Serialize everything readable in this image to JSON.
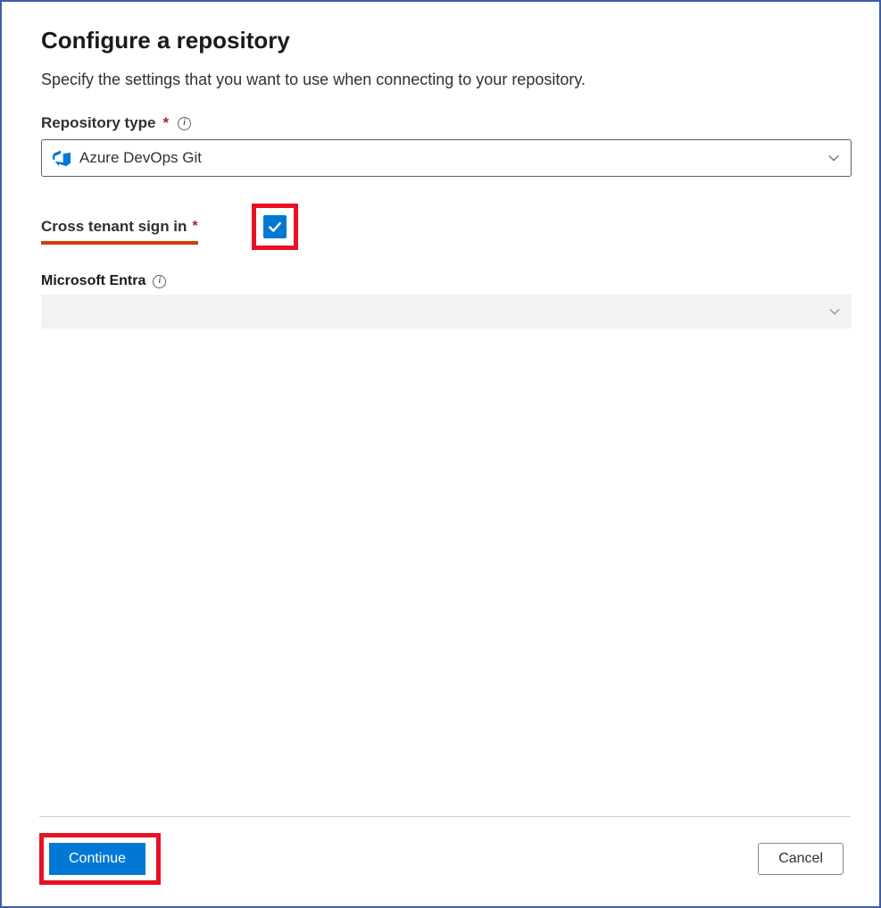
{
  "heading": "Configure a repository",
  "subtitle": "Specify the settings that you want to use when connecting to your repository.",
  "fields": {
    "repo_type": {
      "label": "Repository type",
      "value": "Azure DevOps Git"
    },
    "cross_tenant": {
      "label": "Cross tenant sign in",
      "checked": true
    },
    "entra": {
      "label": "Microsoft Entra",
      "value": ""
    }
  },
  "footer": {
    "continue_label": "Continue",
    "cancel_label": "Cancel"
  },
  "colors": {
    "primary": "#0078d4",
    "highlight": "#e81123",
    "required": "#a4262c"
  }
}
